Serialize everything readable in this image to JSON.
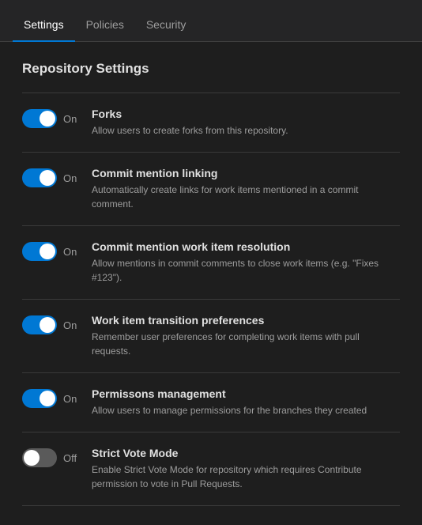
{
  "tabs": [
    {
      "id": "settings",
      "label": "Settings",
      "active": true
    },
    {
      "id": "policies",
      "label": "Policies",
      "active": false
    },
    {
      "id": "security",
      "label": "Security",
      "active": false
    }
  ],
  "section": {
    "title": "Repository Settings"
  },
  "settings": [
    {
      "id": "forks",
      "toggleState": "on",
      "toggleLabel": "On",
      "name": "Forks",
      "description": "Allow users to create forks from this repository."
    },
    {
      "id": "commit-mention-linking",
      "toggleState": "on",
      "toggleLabel": "On",
      "name": "Commit mention linking",
      "description": "Automatically create links for work items mentioned in a commit comment."
    },
    {
      "id": "commit-mention-work-item",
      "toggleState": "on",
      "toggleLabel": "On",
      "name": "Commit mention work item resolution",
      "description": "Allow mentions in commit comments to close work items (e.g. \"Fixes #123\")."
    },
    {
      "id": "work-item-transition",
      "toggleState": "on",
      "toggleLabel": "On",
      "name": "Work item transition preferences",
      "description": "Remember user preferences for completing work items with pull requests."
    },
    {
      "id": "permissions-management",
      "toggleState": "on",
      "toggleLabel": "On",
      "name": "Permissons management",
      "description": "Allow users to manage permissions for the branches they created"
    },
    {
      "id": "strict-vote-mode",
      "toggleState": "off",
      "toggleLabel": "Off",
      "name": "Strict Vote Mode",
      "description": "Enable Strict Vote Mode for repository which requires Contribute permission to vote in Pull Requests."
    }
  ]
}
